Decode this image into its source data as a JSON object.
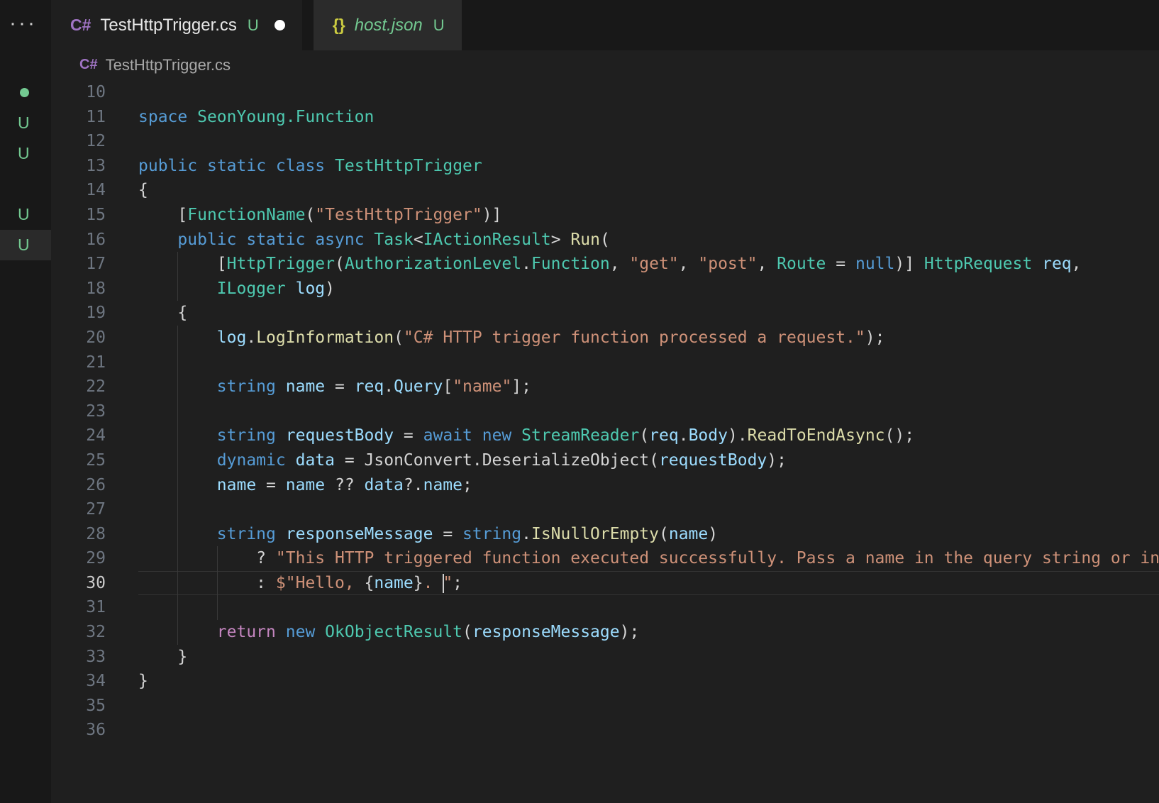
{
  "colors": {
    "editor_bg": "#1f1f1f",
    "sidebar_bg": "#181818",
    "tabbar_bg": "#181818",
    "tab_active_bg": "#1f1f1f",
    "tab_inactive_bg": "#2b2b2b",
    "tab_text": "#e7e7e7",
    "git_untracked": "#73c991",
    "csharp_icon": "#a074c4",
    "json_icon": "#cbcb41",
    "breadcrumb_text": "#a9a9a9",
    "line_number": "#6e7681",
    "line_number_active": "#cccccc",
    "cursor": "#cfcfcf",
    "indent_guide": "#393939",
    "current_line_border": "#343434",
    "selected_row_bg": "#ffffff14",
    "overflow_dots": "#cccccc",
    "modified_dot": "#ffffff",
    "kw": "#569cd6",
    "ct": "#c586c0",
    "ty": "#4ec9b0",
    "st": "#ce9178",
    "va": "#9cdcfe",
    "fn": "#dcdcaa",
    "pl": "#d4d4d4"
  },
  "sidebar": {
    "overflow_label": "···",
    "rows": [
      {
        "type": "dot"
      },
      {
        "type": "badge",
        "label": "U"
      },
      {
        "type": "badge",
        "label": "U"
      },
      {
        "type": "empty"
      },
      {
        "type": "badge",
        "label": "U"
      },
      {
        "type": "badge",
        "label": "U",
        "selected": true
      }
    ]
  },
  "tabs": [
    {
      "id": "tab-testhttptrigger-cs",
      "icon": "csharp",
      "icon_label": "C#",
      "label": "TestHttpTrigger.cs",
      "badge": "U",
      "modified": true,
      "active": true,
      "preview": false
    },
    {
      "id": "tab-host-json",
      "icon": "json",
      "icon_label": "{}",
      "label": "host.json",
      "badge": "U",
      "modified": false,
      "active": false,
      "preview": true
    }
  ],
  "breadcrumb": {
    "icon_label": "C#",
    "label": "TestHttpTrigger.cs"
  },
  "editor": {
    "language": "csharp",
    "current_line": 30,
    "cursor": {
      "line": 30,
      "col": 35
    },
    "h_scroll_chars": 4,
    "lines": [
      {
        "n": 10,
        "tokens": []
      },
      {
        "n": 11,
        "tokens": [
          [
            "namespace",
            "kw"
          ],
          [
            " ",
            "pl"
          ],
          [
            "SeonYoung.Function",
            "ty"
          ]
        ]
      },
      {
        "n": 12,
        "tokens": [
          [
            "{",
            "pl"
          ]
        ]
      },
      {
        "n": 13,
        "tokens": [
          [
            "    ",
            "pl"
          ],
          [
            "public",
            "kw"
          ],
          [
            " ",
            "pl"
          ],
          [
            "static",
            "kw"
          ],
          [
            " ",
            "pl"
          ],
          [
            "class",
            "kw"
          ],
          [
            " ",
            "pl"
          ],
          [
            "TestHttpTrigger",
            "ty"
          ]
        ]
      },
      {
        "n": 14,
        "tokens": [
          [
            "    {",
            "pl"
          ]
        ]
      },
      {
        "n": 15,
        "tokens": [
          [
            "        [",
            "pl"
          ],
          [
            "FunctionName",
            "ty"
          ],
          [
            "(",
            "pl"
          ],
          [
            "\"TestHttpTrigger\"",
            "st"
          ],
          [
            ")]",
            "pl"
          ]
        ]
      },
      {
        "n": 16,
        "tokens": [
          [
            "        ",
            "pl"
          ],
          [
            "public",
            "kw"
          ],
          [
            " ",
            "pl"
          ],
          [
            "static",
            "kw"
          ],
          [
            " ",
            "pl"
          ],
          [
            "async",
            "kw"
          ],
          [
            " ",
            "pl"
          ],
          [
            "Task",
            "ty"
          ],
          [
            "<",
            "pl"
          ],
          [
            "IActionResult",
            "ty"
          ],
          [
            "> ",
            "pl"
          ],
          [
            "Run",
            "fn"
          ],
          [
            "(",
            "pl"
          ]
        ]
      },
      {
        "n": 17,
        "guides": [
          8
        ],
        "tokens": [
          [
            "            [",
            "pl"
          ],
          [
            "HttpTrigger",
            "ty"
          ],
          [
            "(",
            "pl"
          ],
          [
            "AuthorizationLevel",
            "ty"
          ],
          [
            ".",
            "pl"
          ],
          [
            "Function",
            "ty"
          ],
          [
            ", ",
            "pl"
          ],
          [
            "\"get\"",
            "st"
          ],
          [
            ", ",
            "pl"
          ],
          [
            "\"post\"",
            "st"
          ],
          [
            ", ",
            "pl"
          ],
          [
            "Route",
            "ty"
          ],
          [
            " = ",
            "pl"
          ],
          [
            "null",
            "kw"
          ],
          [
            ")] ",
            "pl"
          ],
          [
            "HttpRequest",
            "ty"
          ],
          [
            " ",
            "pl"
          ],
          [
            "req",
            "va"
          ],
          [
            ",",
            "pl"
          ]
        ]
      },
      {
        "n": 18,
        "guides": [
          8
        ],
        "tokens": [
          [
            "            ",
            "pl"
          ],
          [
            "ILogger",
            "ty"
          ],
          [
            " ",
            "pl"
          ],
          [
            "log",
            "va"
          ],
          [
            ")",
            "pl"
          ]
        ]
      },
      {
        "n": 19,
        "tokens": [
          [
            "        {",
            "pl"
          ]
        ]
      },
      {
        "n": 20,
        "guides": [
          8
        ],
        "tokens": [
          [
            "            ",
            "pl"
          ],
          [
            "log",
            "va"
          ],
          [
            ".",
            "pl"
          ],
          [
            "LogInformation",
            "fn"
          ],
          [
            "(",
            "pl"
          ],
          [
            "\"C# HTTP trigger function processed a request.\"",
            "st"
          ],
          [
            ");",
            "pl"
          ]
        ]
      },
      {
        "n": 21,
        "guides": [
          8
        ],
        "tokens": []
      },
      {
        "n": 22,
        "guides": [
          8
        ],
        "tokens": [
          [
            "            ",
            "pl"
          ],
          [
            "string",
            "kw"
          ],
          [
            " ",
            "pl"
          ],
          [
            "name",
            "va"
          ],
          [
            " = ",
            "pl"
          ],
          [
            "req",
            "va"
          ],
          [
            ".",
            "pl"
          ],
          [
            "Query",
            "va"
          ],
          [
            "[",
            "pl"
          ],
          [
            "\"name\"",
            "st"
          ],
          [
            "];",
            "pl"
          ]
        ]
      },
      {
        "n": 23,
        "guides": [
          8
        ],
        "tokens": []
      },
      {
        "n": 24,
        "guides": [
          8
        ],
        "tokens": [
          [
            "            ",
            "pl"
          ],
          [
            "string",
            "kw"
          ],
          [
            " ",
            "pl"
          ],
          [
            "requestBody",
            "va"
          ],
          [
            " = ",
            "pl"
          ],
          [
            "await",
            "kw"
          ],
          [
            " ",
            "pl"
          ],
          [
            "new",
            "kw"
          ],
          [
            " ",
            "pl"
          ],
          [
            "StreamReader",
            "ty"
          ],
          [
            "(",
            "pl"
          ],
          [
            "req",
            "va"
          ],
          [
            ".",
            "pl"
          ],
          [
            "Body",
            "va"
          ],
          [
            ").",
            "pl"
          ],
          [
            "ReadToEndAsync",
            "fn"
          ],
          [
            "();",
            "pl"
          ]
        ]
      },
      {
        "n": 25,
        "guides": [
          8
        ],
        "tokens": [
          [
            "            ",
            "pl"
          ],
          [
            "dynamic",
            "kw"
          ],
          [
            " ",
            "pl"
          ],
          [
            "data",
            "va"
          ],
          [
            " = ",
            "pl"
          ],
          [
            "JsonConvert.DeserializeObject(",
            "pl"
          ],
          [
            "requestBody",
            "va"
          ],
          [
            ");",
            "pl"
          ]
        ]
      },
      {
        "n": 26,
        "guides": [
          8
        ],
        "tokens": [
          [
            "            ",
            "pl"
          ],
          [
            "name",
            "va"
          ],
          [
            " = ",
            "pl"
          ],
          [
            "name",
            "va"
          ],
          [
            " ?? ",
            "pl"
          ],
          [
            "data",
            "va"
          ],
          [
            "?.",
            "pl"
          ],
          [
            "name",
            "va"
          ],
          [
            ";",
            "pl"
          ]
        ]
      },
      {
        "n": 27,
        "guides": [
          8
        ],
        "tokens": []
      },
      {
        "n": 28,
        "guides": [
          8
        ],
        "tokens": [
          [
            "            ",
            "pl"
          ],
          [
            "string",
            "kw"
          ],
          [
            " ",
            "pl"
          ],
          [
            "responseMessage",
            "va"
          ],
          [
            " = ",
            "pl"
          ],
          [
            "string",
            "kw"
          ],
          [
            ".",
            "pl"
          ],
          [
            "IsNullOrEmpty",
            "fn"
          ],
          [
            "(",
            "pl"
          ],
          [
            "name",
            "va"
          ],
          [
            ")",
            "pl"
          ]
        ]
      },
      {
        "n": 29,
        "guides": [
          8,
          12
        ],
        "tokens": [
          [
            "                ? ",
            "pl"
          ],
          [
            "\"This HTTP triggered function executed successfully. Pass a name in the query string or in the request body for a personalized response.\"",
            "st"
          ]
        ]
      },
      {
        "n": 30,
        "guides": [
          8,
          12
        ],
        "tokens": [
          [
            "                : ",
            "pl"
          ],
          [
            "$\"Hello, ",
            "st"
          ],
          [
            "{",
            "pl"
          ],
          [
            "name",
            "va"
          ],
          [
            "}",
            "pl"
          ],
          [
            ". ",
            "st"
          ],
          [
            "\"",
            "st"
          ],
          [
            ";",
            "pl"
          ]
        ]
      },
      {
        "n": 31,
        "guides": [
          8,
          12
        ],
        "tokens": []
      },
      {
        "n": 32,
        "guides": [
          8
        ],
        "tokens": [
          [
            "            ",
            "pl"
          ],
          [
            "return",
            "ct"
          ],
          [
            " ",
            "pl"
          ],
          [
            "new",
            "kw"
          ],
          [
            " ",
            "pl"
          ],
          [
            "OkObjectResult",
            "ty"
          ],
          [
            "(",
            "pl"
          ],
          [
            "responseMessage",
            "va"
          ],
          [
            ");",
            "pl"
          ]
        ]
      },
      {
        "n": 33,
        "tokens": [
          [
            "        }",
            "pl"
          ]
        ]
      },
      {
        "n": 34,
        "tokens": [
          [
            "    }",
            "pl"
          ]
        ]
      },
      {
        "n": 35,
        "tokens": [
          [
            "}",
            "pl"
          ]
        ]
      },
      {
        "n": 36,
        "tokens": []
      }
    ]
  }
}
